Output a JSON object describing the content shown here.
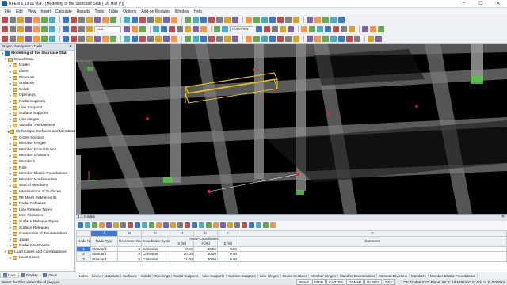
{
  "window": {
    "title": "RFEM 5.19.01 x64 - [Modelling of the Staircase Slab | 1st Half (*)]",
    "controls": [
      "–",
      "☐",
      "✕"
    ]
  },
  "menu": [
    "File",
    "Edit",
    "View",
    "Insert",
    "Calculate",
    "Results",
    "Tools",
    "Table",
    "Options",
    "Add-on Modules",
    "Window",
    "Help"
  ],
  "toolbar": {
    "combo_loadcase": "LC1",
    "combo_view": "NodeView"
  },
  "navigator": {
    "title": "Project Navigator - Data",
    "project": "Modelling of the Staircase Slab",
    "model_data": "Model Data",
    "items": [
      "Nodes",
      "Lines",
      "Materials",
      "Surfaces",
      "Solids",
      "Openings",
      "Nodal Supports",
      "Line Supports",
      "Surface Supports",
      "Line Hinges",
      "Variable Thicknesses",
      "Orthotropic Surfaces and Membranes",
      "Cross-Sections",
      "Member Hinges",
      "Member Eccentricities",
      "Member Divisions",
      "Members",
      "Ribs",
      "Member Elastic Foundations",
      "Member Nonlinearities",
      "Sets of Members",
      "Intersections of Surfaces",
      "FE Mesh Refinements",
      "Nodal Releases",
      "Line Release Types",
      "Line Releases",
      "Surface Release Types",
      "Surface Releases",
      "Connection of Two Members",
      "Joints",
      "Nodal Constraints"
    ],
    "bottom_items": [
      "Load Cases and Combinations",
      "Load Cases"
    ],
    "tabs": [
      "Data",
      "Display",
      "Views"
    ]
  },
  "table": {
    "title": "1.1 Nodes",
    "column_letters": [
      "A",
      "B",
      "C",
      "D",
      "E",
      "F",
      "G"
    ],
    "group_header": "Node Coordinates",
    "headers": [
      "Node No.",
      "Node Type",
      "Reference Node",
      "Coordinate System",
      "X [m]",
      "Y [m]",
      "Z [m]",
      "Comment"
    ],
    "rows": [
      {
        "no": "1",
        "type": "Standard",
        "ref": "0",
        "system": "Cartesian",
        "x": "0.00",
        "y": "30.50",
        "z": "0.00",
        "comment": ""
      },
      {
        "no": "2",
        "type": "Standard",
        "ref": "0",
        "system": "Cartesian",
        "x": "20.00",
        "y": "30.50",
        "z": "0.00",
        "comment": ""
      },
      {
        "no": "3",
        "type": "Standard",
        "ref": "0",
        "system": "Cartesian",
        "x": "32.00",
        "y": "30.50",
        "z": "0.00",
        "comment": ""
      }
    ],
    "tabs": [
      "Nodes",
      "Lines",
      "Materials",
      "Surfaces",
      "Solids",
      "Openings",
      "Nodal Supports",
      "Line Supports",
      "Surface Supports",
      "Line Hinges",
      "Cross-Sections",
      "Member Hinges",
      "Member Eccentricities",
      "Member Divisions",
      "Members",
      "Member Elastic Foundations"
    ]
  },
  "status": {
    "message": "Select the third vertex the of polygon.",
    "buttons": [
      "SNAP",
      "GRID",
      "CARTES",
      "OSNAP",
      "GLINES",
      "DXF"
    ],
    "info": "CS: Global XYZ; Plane: XY     X: 16.528 m   Y: 22.502 m   Z: 0.000 m"
  },
  "colors": {
    "accent": "#3f7ad1",
    "viewport_bg": "#000000",
    "highlight": "#e6c800"
  }
}
